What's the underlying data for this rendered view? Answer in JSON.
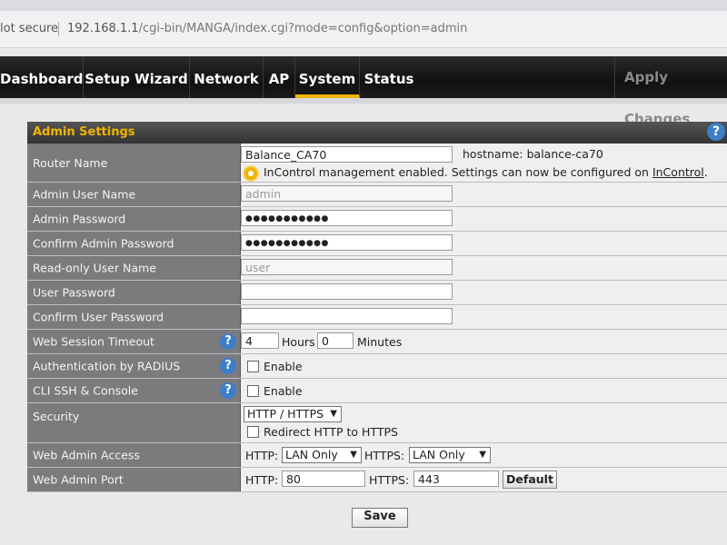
{
  "browser": {
    "security": "lot secure",
    "url_host": "192.168.1.1",
    "url_path": "/cgi-bin/MANGA/index.cgi?mode=config&option=admin"
  },
  "nav": {
    "tabs": [
      "Dashboard",
      "Setup Wizard",
      "Network",
      "AP",
      "System",
      "Status"
    ],
    "active": "System",
    "apply": "Apply Changes"
  },
  "panel": {
    "title": "Admin Settings",
    "help": "?",
    "router_name": {
      "label": "Router Name",
      "value": "Balance_CA70",
      "hostname": "hostname: balance-ca70",
      "notice": "InControl management enabled. Settings can now be configured on ",
      "notice_link": "InControl",
      "notice_end": "."
    },
    "admin_user": {
      "label": "Admin User Name",
      "value": "admin"
    },
    "admin_password": {
      "label": "Admin Password",
      "value": "●●●●●●●●●●●"
    },
    "confirm_admin_password": {
      "label": "Confirm Admin Password",
      "value": "●●●●●●●●●●●"
    },
    "readonly_user": {
      "label": "Read-only User Name",
      "value": "user"
    },
    "user_password": {
      "label": "User Password",
      "value": ""
    },
    "confirm_user_password": {
      "label": "Confirm User Password",
      "value": ""
    },
    "session_timeout": {
      "label": "Web Session Timeout",
      "hours": "4",
      "hours_label": "Hours",
      "minutes": "0",
      "minutes_label": "Minutes"
    },
    "radius": {
      "label": "Authentication by RADIUS",
      "option": "Enable",
      "checked": false
    },
    "ssh": {
      "label": "CLI SSH & Console",
      "option": "Enable",
      "checked": false
    },
    "security": {
      "label": "Security",
      "selected": "HTTP / HTTPS",
      "redirect": "Redirect HTTP to HTTPS",
      "redirect_checked": false
    },
    "access": {
      "label": "Web Admin Access",
      "http_label": "HTTP:",
      "http_value": "LAN Only",
      "https_label": "HTTPS:",
      "https_value": "LAN Only"
    },
    "port": {
      "label": "Web Admin Port",
      "http_label": "HTTP:",
      "http_value": "80",
      "https_label": "HTTPS:",
      "https_value": "443",
      "default": "Default"
    }
  },
  "save": "Save",
  "colors": {
    "accent": "#f0b400",
    "nav_bg": "#111111",
    "label_bg": "#7b7b7e",
    "help": "#3d7ec8"
  }
}
